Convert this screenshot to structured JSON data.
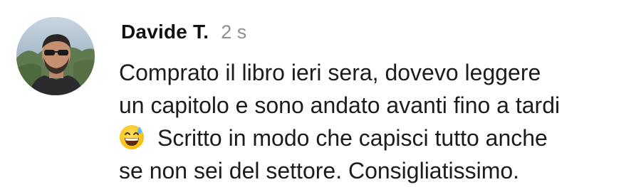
{
  "comment": {
    "author": "Davide T.",
    "timestamp": "2 s",
    "lines": [
      "Comprato il libro ieri sera, dovevo leggere",
      "un capitolo e sono andato avanti fino a tardi",
      "Scritto in modo che capisci tutto anche",
      "se non sei del settore. Consigliatissimo."
    ],
    "emoji": "grinning-face-with-sweat",
    "avatar_icon": "profile-photo"
  }
}
